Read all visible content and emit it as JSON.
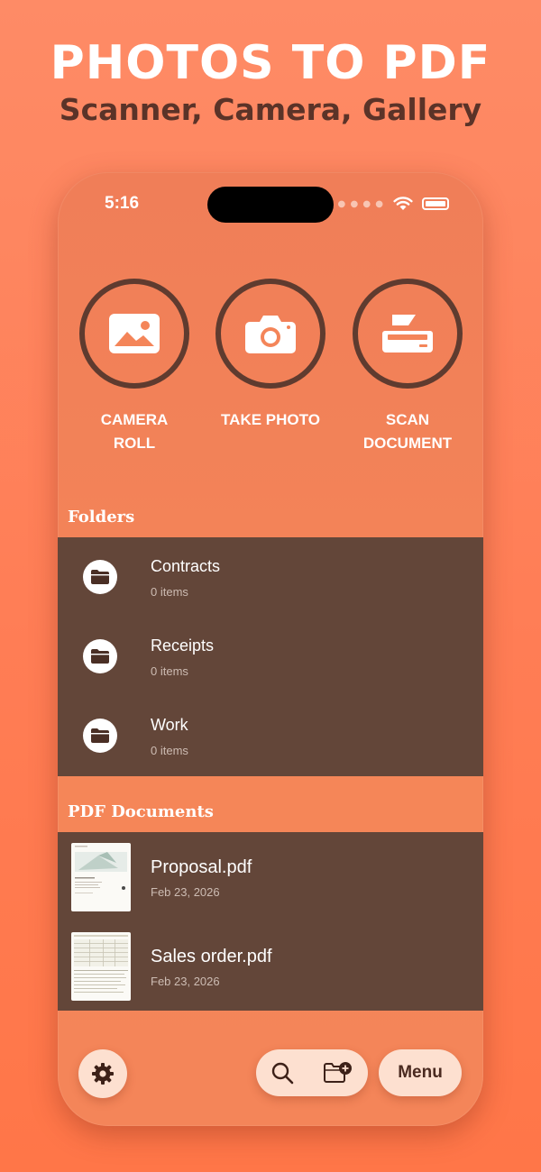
{
  "promo": {
    "headline": "PHOTOS TO PDF",
    "subline": "Scanner, Camera, Gallery"
  },
  "status_bar": {
    "time": "5:16",
    "icons": [
      "cellular-dots-icon",
      "wifi-icon",
      "battery-icon"
    ]
  },
  "actions": [
    {
      "line1": "CAMERA",
      "line2": "ROLL",
      "icon": "image-icon"
    },
    {
      "line1": "TAKE PHOTO",
      "line2": "",
      "icon": "camera-icon"
    },
    {
      "line1": "SCAN",
      "line2": "DOCUMENT",
      "icon": "scanner-icon"
    }
  ],
  "folders": {
    "title": "Folders",
    "items": [
      {
        "name": "Contracts",
        "count": "0 items",
        "icon": "folder-icon"
      },
      {
        "name": "Receipts",
        "count": "0 items",
        "icon": "folder-icon"
      },
      {
        "name": "Work",
        "count": "0 items",
        "icon": "folder-icon"
      }
    ]
  },
  "documents": {
    "title": "PDF Documents",
    "items": [
      {
        "name": "Proposal.pdf",
        "date": "Feb 23, 2026"
      },
      {
        "name": "Sales order.pdf",
        "date": "Feb 23, 2026"
      }
    ]
  },
  "toolbar": {
    "settings_icon": "gear-icon",
    "search_icon": "search-icon",
    "new_folder_icon": "folder-plus-icon",
    "menu_label": "Menu"
  },
  "colors": {
    "background": "#ff7d55",
    "phone_surface": "#f48559",
    "list_background": "#634639",
    "ring": "#5f3b2f",
    "pill": "#fde0d0"
  }
}
